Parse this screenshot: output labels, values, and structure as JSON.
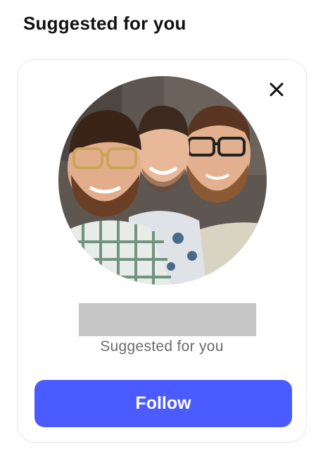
{
  "section": {
    "title": "Suggested for you"
  },
  "card": {
    "close_icon": "close-icon",
    "avatar_alt": "profile-photo",
    "subtitle": "Suggested for you",
    "follow_label": "Follow",
    "colors": {
      "button": "#4a5bff",
      "button_text": "#ffffff",
      "subtitle": "#6b6b6b",
      "redaction": "#c6c6c6"
    }
  }
}
